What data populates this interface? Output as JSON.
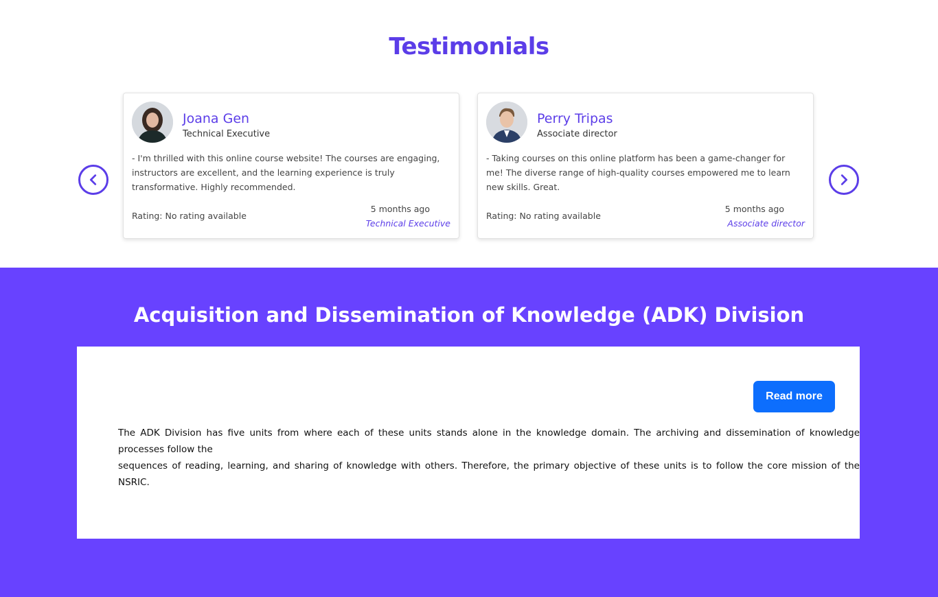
{
  "testimonials": {
    "title": "Testimonials",
    "cards": [
      {
        "name": "Joana Gen",
        "role": "Technical Executive",
        "quote": "- I'm thrilled with this online course website! The courses are engaging, instructors are excellent, and the learning experience is truly transformative. Highly recommended.",
        "rating": "Rating: No rating available",
        "date": "5 months ago",
        "tag": "Technical Executive"
      },
      {
        "name": "Perry Tripas",
        "role": "Associate director",
        "quote": "- Taking courses on this online platform has been a game-changer for me! The diverse range of high-quality courses empowered me to learn new skills. Great.",
        "rating": "Rating: No rating available",
        "date": "5 months ago",
        "tag": "Associate director"
      }
    ],
    "prev_icon": "chevron-left-icon",
    "next_icon": "chevron-right-icon"
  },
  "adk": {
    "title": "Acquisition and Dissemination of Knowledge (ADK) Division",
    "read_more": "Read more",
    "paragraph_1": "The ADK Division has five units from where each of these units stands alone in the knowledge domain. The archiving and dissemination of knowledge processes follow the",
    "paragraph_2": "sequences of reading, learning, and sharing of knowledge with others. Therefore, the primary objective of these units is to follow the core mission of the NSRIC."
  },
  "colors": {
    "accent": "#5b3de8",
    "band": "#6842ff",
    "button": "#0d6efd"
  }
}
